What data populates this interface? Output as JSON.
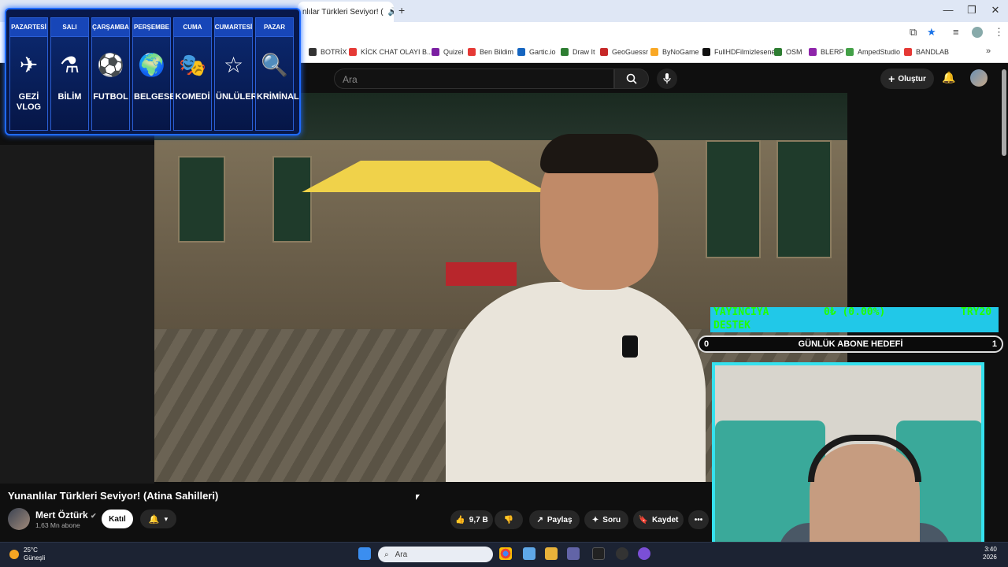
{
  "browser": {
    "tab_title": "nlılar Türkleri Seviyor! (",
    "new_tab": "+",
    "window_controls": [
      "—",
      "❐",
      "✕"
    ]
  },
  "bookmarks": [
    {
      "label": "BOTRİX",
      "color": "#333"
    },
    {
      "label": "KİCK CHAT OLAYI B...",
      "color": "#e53935"
    },
    {
      "label": "Quizei",
      "color": "#7b1fa2"
    },
    {
      "label": "Ben Bildim",
      "color": "#e53935"
    },
    {
      "label": "Gartic.io",
      "color": "#1565c0"
    },
    {
      "label": "Draw It",
      "color": "#2e7d32"
    },
    {
      "label": "GeoGuessr",
      "color": "#c62828"
    },
    {
      "label": "ByNoGame",
      "color": "#f9a825"
    },
    {
      "label": "FullHDFilmizlesene",
      "color": "#111"
    },
    {
      "label": "OSM",
      "color": "#2e7d32"
    },
    {
      "label": "BLERP",
      "color": "#8e24aa"
    },
    {
      "label": "AmpedStudio",
      "color": "#43a047"
    },
    {
      "label": "BANDLAB",
      "color": "#e53935"
    }
  ],
  "youtube": {
    "search_placeholder": "Ara",
    "create_label": "Oluştur"
  },
  "schedule": [
    {
      "day": "PAZARTESİ",
      "label": "GEZİ VLOG",
      "icon": "globe-plane-icon",
      "glyph": "✈"
    },
    {
      "day": "SALI",
      "label": "BİLİM",
      "icon": "flask-icon",
      "glyph": "⚗"
    },
    {
      "day": "ÇARŞAMBA",
      "label": "FUTBOL",
      "icon": "soccer-ball-icon",
      "glyph": "⚽"
    },
    {
      "day": "PERŞEMBE",
      "label": "BELGESEL",
      "icon": "globe-icon",
      "glyph": "🌍"
    },
    {
      "day": "CUMA",
      "label": "KOMEDİ",
      "icon": "comedy-mask-icon",
      "glyph": "🎭"
    },
    {
      "day": "CUMARTESİ",
      "label": "ÜNLÜLER",
      "icon": "star-icon",
      "glyph": "☆"
    },
    {
      "day": "PAZAR",
      "label": "KRİMİNAL",
      "icon": "fingerprint-icon",
      "glyph": "🔍"
    }
  ],
  "overlay": {
    "donation_left": "YAYINCIYA",
    "donation_mid": "0₺ (0.00%)",
    "donation_right": "TRY20",
    "donation_line2": "DESTEK",
    "goal_start": "0",
    "goal_label": "GÜNLÜK ABONE HEDEFİ",
    "goal_end": "1"
  },
  "video": {
    "title": "Yunanlılar Türkleri Seviyor! (Atina Sahilleri)",
    "channel": "Mert Öztürk",
    "subscribers": "1,63 Mn abone",
    "join_label": "Katıl",
    "likes": "9,7 B",
    "share_label": "Paylaş",
    "ask_label": "Soru",
    "save_label": "Kaydet",
    "more_label": "•••"
  },
  "taskbar": {
    "temperature": "25°C",
    "weather": "Güneşli",
    "search_placeholder": "Ara",
    "time": "3:40",
    "year": "2026"
  }
}
